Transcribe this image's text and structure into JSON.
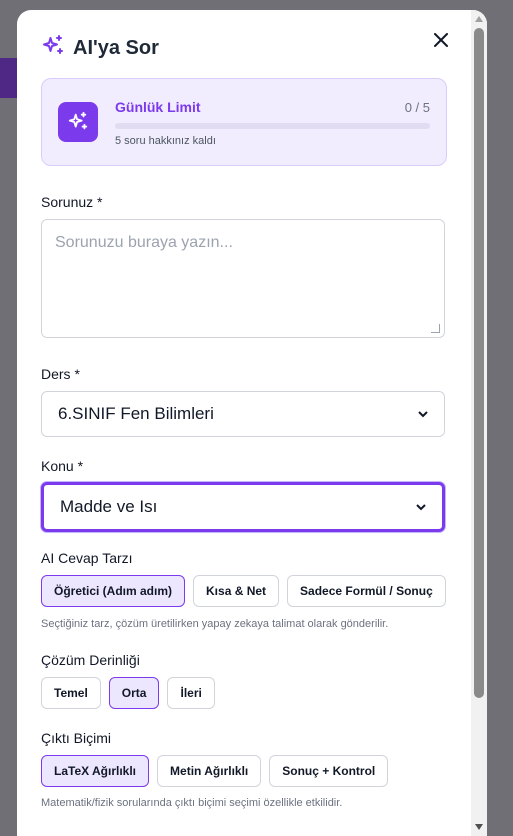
{
  "modal": {
    "title": "AI'ya Sor",
    "close_icon": "close-icon",
    "title_icon": "sparkle-icon"
  },
  "limit": {
    "title": "Günlük Limit",
    "count": "0 / 5",
    "progress_fraction": 0,
    "subtitle": "5 soru hakkınız kaldı",
    "icon": "sparkle-icon"
  },
  "question": {
    "label": "Sorunuz *",
    "placeholder": "Sorunuzu buraya yazın..."
  },
  "subject": {
    "label": "Ders *",
    "value": "6.SINIF Fen Bilimleri"
  },
  "topic": {
    "label": "Konu *",
    "value": "Madde ve Isı"
  },
  "style": {
    "label": "AI Cevap Tarzı",
    "options": [
      "Öğretici (Adım adım)",
      "Kısa & Net",
      "Sadece Formül / Sonuç"
    ],
    "selected": "Öğretici (Adım adım)",
    "hint": "Seçtiğiniz tarz, çözüm üretilirken yapay zekaya talimat olarak gönderilir."
  },
  "depth": {
    "label": "Çözüm Derinliği",
    "options": [
      "Temel",
      "Orta",
      "İleri"
    ],
    "selected": "Orta"
  },
  "output": {
    "label": "Çıktı Biçimi",
    "options": [
      "LaTeX Ağırlıklı",
      "Metin Ağırlıklı",
      "Sonuç + Kontrol"
    ],
    "selected": "LaTeX Ağırlıklı",
    "hint": "Matematik/fizik sorularında çıktı biçimi seçimi özellikle etkilidir."
  },
  "colors": {
    "accent": "#7c3aed",
    "accent_light": "#ede6ff"
  }
}
